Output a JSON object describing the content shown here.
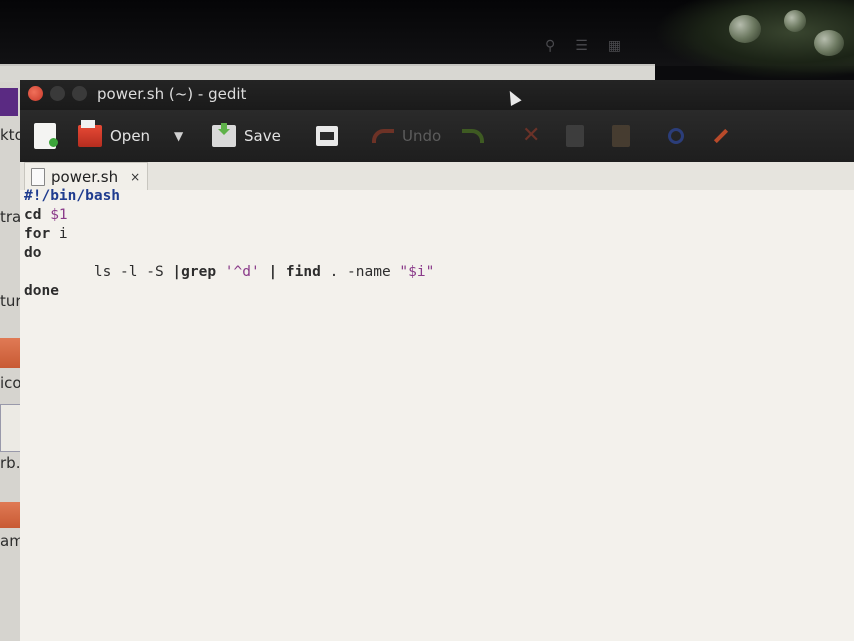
{
  "window": {
    "title": "power.sh (~) - gedit"
  },
  "toolbar": {
    "open_label": "Open",
    "save_label": "Save",
    "undo_label": "Undo"
  },
  "tab": {
    "label": "power.sh",
    "close_glyph": "×"
  },
  "desktop": {
    "labels": [
      "kto",
      "tra",
      "ture",
      "icor",
      "rb.o",
      "ampl"
    ]
  },
  "editor": {
    "lines": [
      {
        "parts": [
          {
            "t": "#!/bin/bash",
            "c": "shebang"
          }
        ]
      },
      {
        "parts": [
          {
            "t": "cd ",
            "c": "kw-bold"
          },
          {
            "t": "$1",
            "c": "var"
          }
        ]
      },
      {
        "parts": [
          {
            "t": "for ",
            "c": "kw-bold"
          },
          {
            "t": "i",
            "c": "plain"
          }
        ]
      },
      {
        "parts": [
          {
            "t": "do",
            "c": "kw-bold"
          }
        ]
      },
      {
        "parts": [
          {
            "t": "        ls -l -S ",
            "c": "plain"
          },
          {
            "t": "|",
            "c": "op"
          },
          {
            "t": "grep ",
            "c": "kw-bold"
          },
          {
            "t": "'^d'",
            "c": "str"
          },
          {
            "t": " ",
            "c": "plain"
          },
          {
            "t": "|",
            "c": "op"
          },
          {
            "t": " ",
            "c": "plain"
          },
          {
            "t": "find",
            "c": "kw-bold"
          },
          {
            "t": " . -name ",
            "c": "plain"
          },
          {
            "t": "\"$i\"",
            "c": "str"
          }
        ]
      },
      {
        "parts": [
          {
            "t": "done",
            "c": "kw-bold"
          }
        ]
      }
    ]
  },
  "icons": {
    "new": "new-document-icon",
    "open": "open-folder-icon",
    "save": "save-icon",
    "print": "print-icon",
    "undo": "undo-icon",
    "redo": "redo-icon",
    "cut": "cut-icon",
    "copy": "copy-icon",
    "paste": "paste-icon",
    "find": "find-icon",
    "replace": "replace-icon"
  }
}
